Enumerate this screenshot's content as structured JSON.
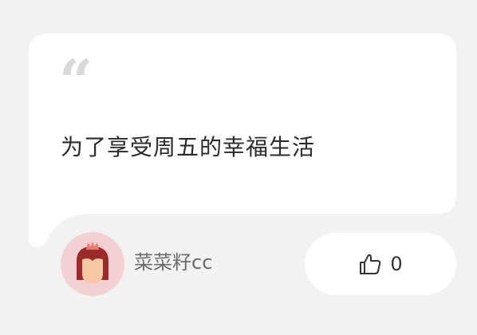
{
  "quote": {
    "mark": "“",
    "text": "为了享受周五的幸福生活"
  },
  "author": {
    "name": "菜菜籽cc",
    "avatar_icon": "girl-avatar-icon"
  },
  "like": {
    "icon": "thumbs-up-icon",
    "count": "0"
  },
  "colors": {
    "page_background": "#f2f2f2",
    "card_background": "#ffffff",
    "quote_mark": "#d9d9d9",
    "avatar_background": "#f3d0d4",
    "hair": "#9b2a2a",
    "crown": "#f07a6a"
  }
}
